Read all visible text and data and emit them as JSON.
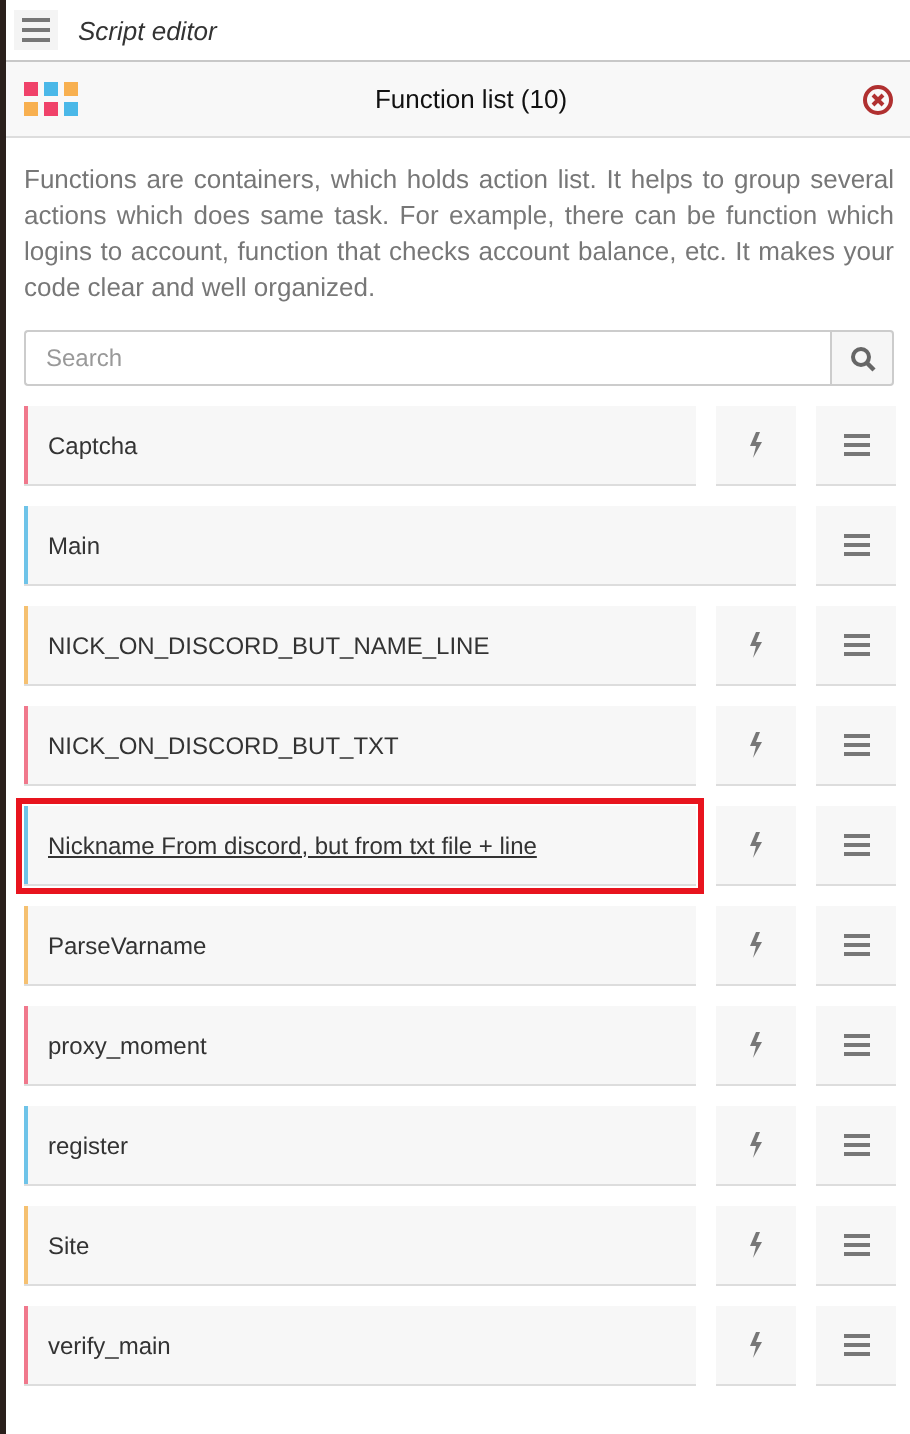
{
  "window": {
    "title": "Script editor"
  },
  "panel": {
    "title": "Function list (10)"
  },
  "description": "Functions are containers, which holds action list. It helps to group several actions which does same task. For example, there can be function which logins to account, function that checks account balance, etc. It makes your code clear and well organized.",
  "search": {
    "placeholder": "Search"
  },
  "functions": [
    {
      "name": "Captcha",
      "color": "#f0788c",
      "runnable": true,
      "highlighted": false
    },
    {
      "name": "Main",
      "color": "#6ec3e8",
      "runnable": false,
      "highlighted": false
    },
    {
      "name": "NICK_ON_DISCORD_BUT_NAME_LINE",
      "color": "#f5c070",
      "runnable": true,
      "highlighted": false
    },
    {
      "name": "NICK_ON_DISCORD_BUT_TXT",
      "color": "#f0788c",
      "runnable": true,
      "highlighted": false
    },
    {
      "name": "Nickname From discord, but from txt file + line",
      "color": "#6ec3e8",
      "runnable": true,
      "highlighted": true
    },
    {
      "name": "ParseVarname",
      "color": "#f5c070",
      "runnable": true,
      "highlighted": false
    },
    {
      "name": "proxy_moment",
      "color": "#f0788c",
      "runnable": true,
      "highlighted": false
    },
    {
      "name": "register",
      "color": "#6ec3e8",
      "runnable": true,
      "highlighted": false
    },
    {
      "name": "Site",
      "color": "#f5c070",
      "runnable": true,
      "highlighted": false
    },
    {
      "name": "verify_main",
      "color": "#f0788c",
      "runnable": true,
      "highlighted": false
    }
  ]
}
